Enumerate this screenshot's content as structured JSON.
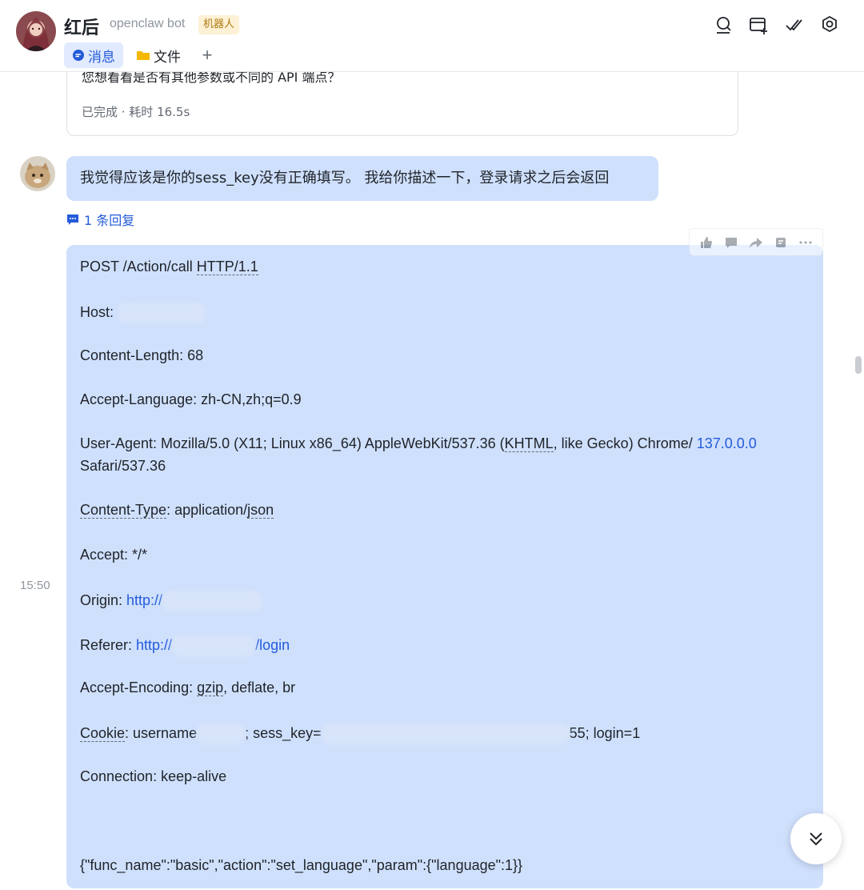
{
  "header": {
    "title": "红后",
    "subtitle": "openclaw bot",
    "badge": "机器人",
    "icons": [
      "search-person-icon",
      "add-window-icon",
      "double-check-icon",
      "settings-gear-icon"
    ]
  },
  "tabs": [
    {
      "label": "消息",
      "icon": "chat-bubble-icon"
    },
    {
      "label": "文件",
      "icon": "folder-icon"
    }
  ],
  "tab_add_label": "+",
  "previous_card": {
    "cut_text": "您想看看是否有其他参数或不同的 API 端点？",
    "status": "已完成 · 耗时 16.5s"
  },
  "user_message": {
    "text": "我觉得应该是你的sess_key没有正确填写。 我给你描述一下，登录请求之后会返回",
    "reply_label": "1 条回复"
  },
  "timestamp": "15:50",
  "request": {
    "line1_a": "POST /Action/call ",
    "line1_b": "HTTP/1.1",
    "host_label": "Host:",
    "content_length": "Content-Length: 68",
    "accept_language": "Accept-Language: zh-CN,zh;q=0.9",
    "ua_a": "User-Agent: Mozilla/5.0 (X11; Linux x86_64) AppleWebKit/537.36 (",
    "ua_b": "KHTML",
    "ua_c": ", like Gecko) Chrome/ ",
    "ua_version": "137.0.0.0",
    "ua_safari": "Safari/537.36",
    "ct_key": "Content-Type",
    "ct_sep": ": application/",
    "ct_val": "json",
    "accept": "Accept: */*",
    "origin_label": "Origin: ",
    "origin_link": "http://",
    "referer_label": "Referer: ",
    "referer_link": "http://",
    "referer_path": "/login",
    "ae_a": "Accept-Encoding: ",
    "ae_b": "gzip",
    "ae_c": ", deflate, br",
    "cookie_key": "Cookie",
    "cookie_a": ": username",
    "cookie_b": "; sess_key=",
    "cookie_c": "55; login=1",
    "connection": "Connection: keep-alive",
    "body": "{\"func_name\":\"basic\",\"action\":\"set_language\",\"param\":{\"language\":1}}"
  },
  "action_bar": [
    "thumbs-up-icon",
    "comment-icon",
    "forward-icon",
    "ding-icon",
    "more-icon"
  ],
  "scroll_button": "chevron-double-down-icon"
}
